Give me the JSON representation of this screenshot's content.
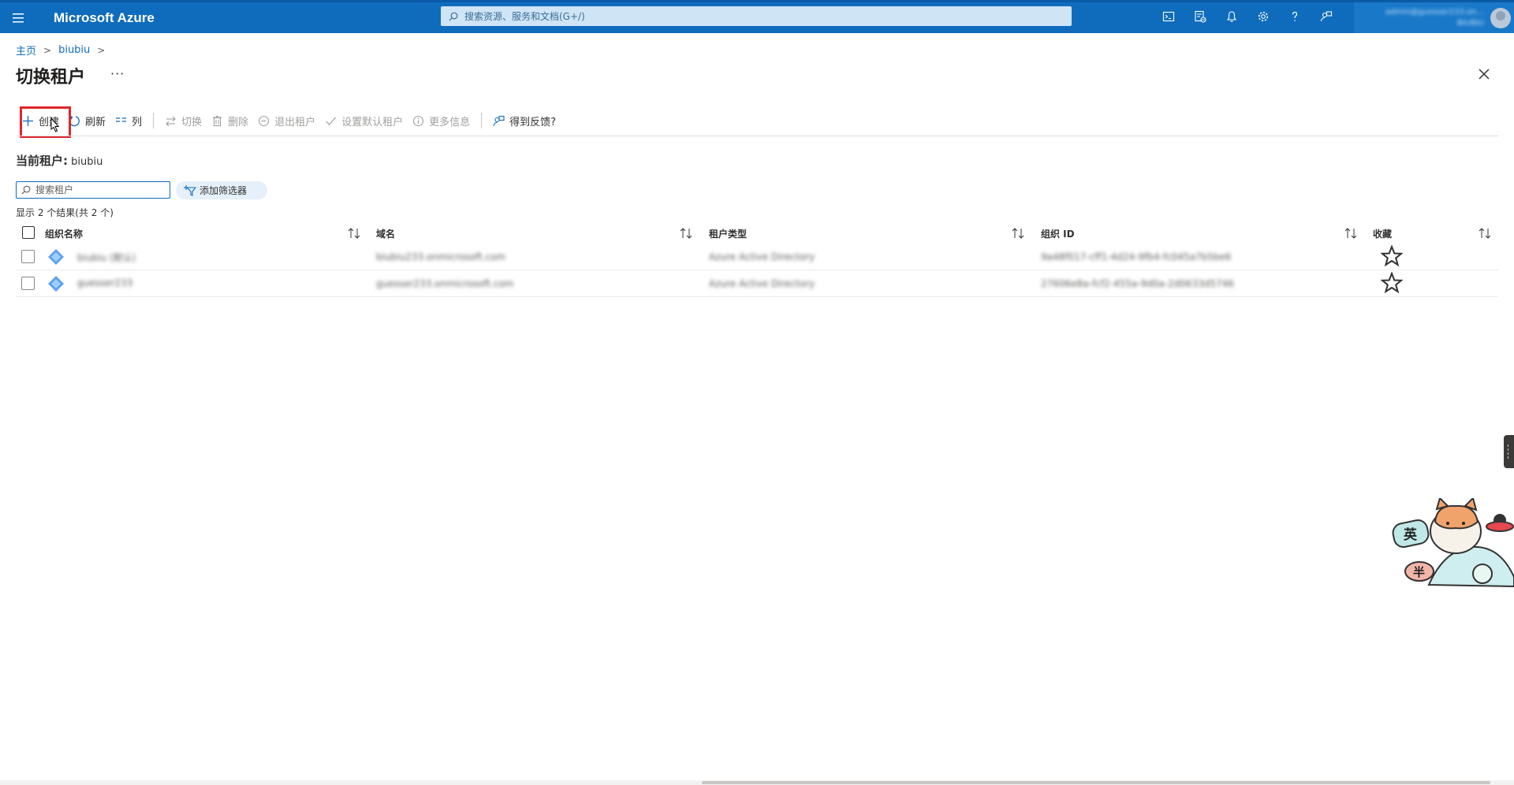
{
  "topbar": {
    "brand": "Microsoft Azure",
    "search_placeholder": "搜索资源、服务和文档(G+/)",
    "icons": [
      "cloud-shell-icon",
      "directory-subscription-icon",
      "notification-bell-icon",
      "settings-gear-icon",
      "help-question-icon",
      "feedback-icon"
    ],
    "accent_color": "#0f6cbd"
  },
  "breadcrumb": {
    "home": "主页",
    "current": "biubiu"
  },
  "page": {
    "title": "切换租户",
    "more": "···"
  },
  "toolbar": {
    "create": "创建",
    "refresh": "刷新",
    "columns": "列",
    "switch": "切换",
    "delete": "删除",
    "leave_tenant": "退出租户",
    "set_default": "设置默认租户",
    "more_info": "更多信息",
    "feedback": "得到反馈?"
  },
  "current_tenant": {
    "label": "当前租户:",
    "value": "biubiu"
  },
  "filter": {
    "search_placeholder": "搜索租户",
    "add_filter": "添加筛选器",
    "result_count": "显示 2 个结果(共 2 个)"
  },
  "table": {
    "columns": {
      "org_name": "组织名称",
      "domain": "域名",
      "tenant_type": "租户类型",
      "org_id": "组织 ID",
      "favorite": "收藏"
    },
    "rows": [
      {
        "org_name": "biubiu (默认)",
        "domain": "biubiu233.onmicrosoft.com",
        "tenant_type": "Azure Active Directory",
        "org_id": "9a48f017-cff1-4d24-9fb4-fc045a7b5be6"
      },
      {
        "org_name": "guesser233",
        "domain": "guesser233.onmicrosoft.com",
        "tenant_type": "Azure Active Directory",
        "org_id": "27606e8a-fcf2-455a-9d0a-2d0633d5746"
      }
    ]
  },
  "account": {
    "email": "admin@guesser233.on...",
    "tenant": "BIUBIU"
  },
  "mascot": {
    "badge_left": "英",
    "badge_bottom": "半"
  }
}
